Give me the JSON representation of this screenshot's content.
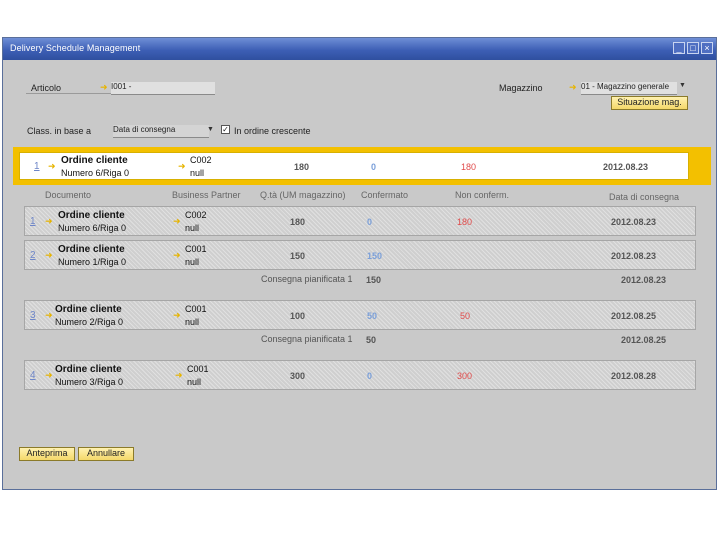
{
  "window": {
    "title": "Delivery Schedule Management",
    "min": "_",
    "max": "□",
    "close": "×"
  },
  "articolo": {
    "label": "Articolo",
    "value": "I001 -"
  },
  "magazzino": {
    "label": "Magazzino",
    "value": "01 - Magazzino generale",
    "button": "Situazione mag."
  },
  "sort": {
    "label": "Class. in base a",
    "value": "Data di consegna",
    "ascending_label": "In ordine crescente",
    "check": "✓"
  },
  "selected": {
    "num": "1",
    "doc_title": "Ordine cliente",
    "doc_sub": "Numero 6/Riga 0",
    "bp_code": "C002",
    "bp_name": "null",
    "qty": "180",
    "confirmed": "0",
    "not_confirmed": "180",
    "date": "2012.08.23"
  },
  "headers": {
    "documento": "Documento",
    "bp": "Business Partner",
    "qty": "Q.tà (UM magazzino)",
    "confirmed": "Confermato",
    "not_confirmed": "Non conferm.",
    "date": "Data di consegna"
  },
  "rows": [
    {
      "num": "1",
      "doc_title": "Ordine cliente",
      "doc_sub": "Numero 6/Riga 0",
      "bp_code": "C002",
      "bp_name": "null",
      "qty": "180",
      "confirmed": "0",
      "not_confirmed": "180",
      "date": "2012.08.23"
    },
    {
      "num": "2",
      "doc_title": "Ordine cliente",
      "doc_sub": "Numero 1/Riga 0",
      "bp_code": "C001",
      "bp_name": "null",
      "qty": "150",
      "confirmed": "150",
      "not_confirmed": "",
      "date": "2012.08.23"
    },
    {
      "num": "3",
      "doc_title": "Ordine cliente",
      "doc_sub": "Numero 2/Riga 0",
      "bp_code": "C001",
      "bp_name": "null",
      "qty": "100",
      "confirmed": "50",
      "not_confirmed": "50",
      "date": "2012.08.25"
    },
    {
      "num": "4",
      "doc_title": "Ordine cliente",
      "doc_sub": "Numero 3/Riga 0",
      "bp_code": "C001",
      "bp_name": "null",
      "qty": "300",
      "confirmed": "0",
      "not_confirmed": "300",
      "date": "2012.08.28"
    }
  ],
  "planned": [
    {
      "label": "Consegna pianificata 1",
      "qty": "150",
      "date": "2012.08.23"
    },
    {
      "label": "Consegna pianificata 1",
      "qty": "50",
      "date": "2012.08.25"
    }
  ],
  "footer": {
    "preview": "Anteprima",
    "cancel": "Annullare"
  }
}
